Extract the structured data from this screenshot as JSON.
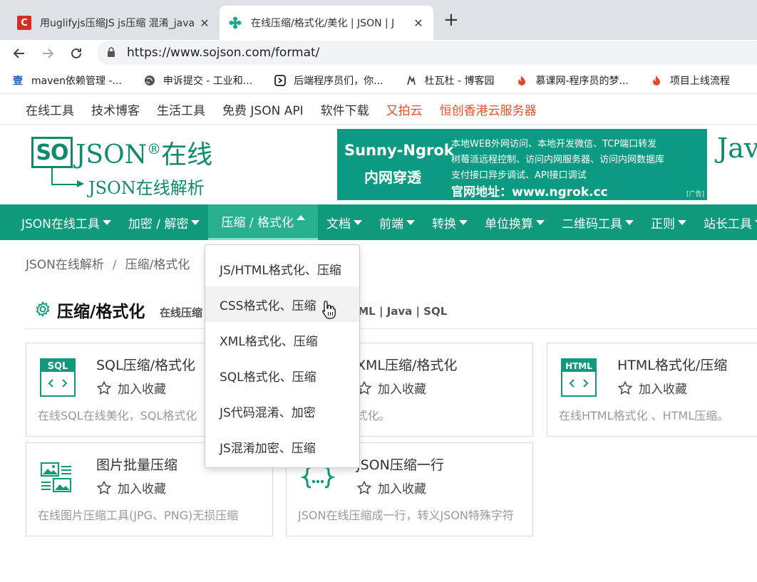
{
  "browser": {
    "tabs": [
      {
        "title": "用uglifyjs压缩JS js压缩 混淆_java",
        "active": false
      },
      {
        "title": "在线压缩/格式化/美化 | JSON | J",
        "active": true
      }
    ],
    "url": "https://www.sojson.com/format/",
    "bookmarks": [
      {
        "label": "maven依赖管理 -...",
        "icon": "book-icon"
      },
      {
        "label": "申诉提交 - 工业和...",
        "icon": "globe-icon"
      },
      {
        "label": "后端程序员们，你...",
        "icon": "code-icon"
      },
      {
        "label": "杜瓦杜 - 博客园",
        "icon": "pen-icon"
      },
      {
        "label": "慕课网-程序员的梦...",
        "icon": "flame-icon"
      },
      {
        "label": "项目上线流程",
        "icon": "flame-icon"
      }
    ]
  },
  "site": {
    "toplinks": [
      {
        "label": "在线工具",
        "highlight": false
      },
      {
        "label": "技术博客",
        "highlight": false
      },
      {
        "label": "生活工具",
        "highlight": false
      },
      {
        "label": "免费 JSON API",
        "highlight": false
      },
      {
        "label": "软件下载",
        "highlight": false
      },
      {
        "label": "又拍云",
        "highlight": true
      },
      {
        "label": "恒创香港云服务器",
        "highlight": true
      }
    ],
    "logo": {
      "badge": "SO",
      "main": "JSON",
      "reg": "®",
      "suffix": "在线",
      "sub": "JSON在线解析"
    },
    "ad": {
      "brand": "Sunny-Ngrok",
      "brand2": "内网穿透",
      "lines": [
        "本地WEB外网访问、本地开发微信、TCP端口转发",
        "树莓派远程控制、访问内网服务器、访问内网数据库",
        "支付接口异步调试、API接口调试",
        "官网地址：www.ngrok.cc"
      ],
      "tag": "[广告]"
    },
    "header_right_text": "Jav",
    "mainnav": [
      {
        "label": "JSON在线工具",
        "active": false
      },
      {
        "label": "加密 / 解密",
        "active": false
      },
      {
        "label": "压缩 / 格式化",
        "active": true
      },
      {
        "label": "文档",
        "active": false
      },
      {
        "label": "前端",
        "active": false
      },
      {
        "label": "转换",
        "active": false
      },
      {
        "label": "单位换算",
        "active": false
      },
      {
        "label": "二维码工具",
        "active": false
      },
      {
        "label": "正则",
        "active": false
      },
      {
        "label": "站长工具",
        "active": false
      }
    ],
    "breadcrumb": {
      "home": "JSON在线解析",
      "sep": "/",
      "current": "压缩/格式化"
    },
    "section": {
      "title": "压缩/格式化",
      "desc_left": "在线压缩",
      "desc_right": "TML | Java | SQL"
    },
    "cards": [
      {
        "title": "SQL压缩/格式化",
        "fav": "加入收藏",
        "desc": "在线SQL在线美化，SQL格式化",
        "icon": "sql-icon"
      },
      {
        "title": "XML压缩/格式化",
        "fav": "加入收藏",
        "desc": "缩，XML格式化。",
        "icon": "xml-icon"
      },
      {
        "title": "HTML格式化/压缩",
        "fav": "加入收藏",
        "desc": "在线HTML格式化 、HTML压缩。",
        "icon": "html-icon"
      },
      {
        "title": "图片批量压缩",
        "fav": "加入收藏",
        "desc": "在线图片压缩工具(JPG、PNG)无损压缩",
        "icon": "image-icon"
      },
      {
        "title": "JSON压缩一行",
        "fav": "加入收藏",
        "desc": "JSON在线压缩成一行，转义JSON特殊字符",
        "icon": "json-icon"
      }
    ],
    "dropdown": [
      "JS/HTML格式化、压缩",
      "CSS格式化、压缩",
      "XML格式化、压缩",
      "SQL格式化、压缩",
      "JS代码混淆、加密",
      "JS混淆加密、压缩"
    ]
  },
  "colors": {
    "brand": "#0f9a7c",
    "accent": "#e94f2a"
  }
}
